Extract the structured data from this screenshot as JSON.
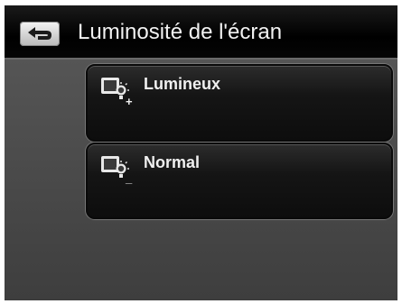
{
  "header": {
    "title": "Luminosité de l'écran",
    "back_icon": "back-arrow-icon"
  },
  "options": [
    {
      "label": "Lumineux",
      "icon": "brightness-plus-icon",
      "symbol": "+"
    },
    {
      "label": "Normal",
      "icon": "brightness-normal-icon",
      "symbol": "_"
    }
  ]
}
